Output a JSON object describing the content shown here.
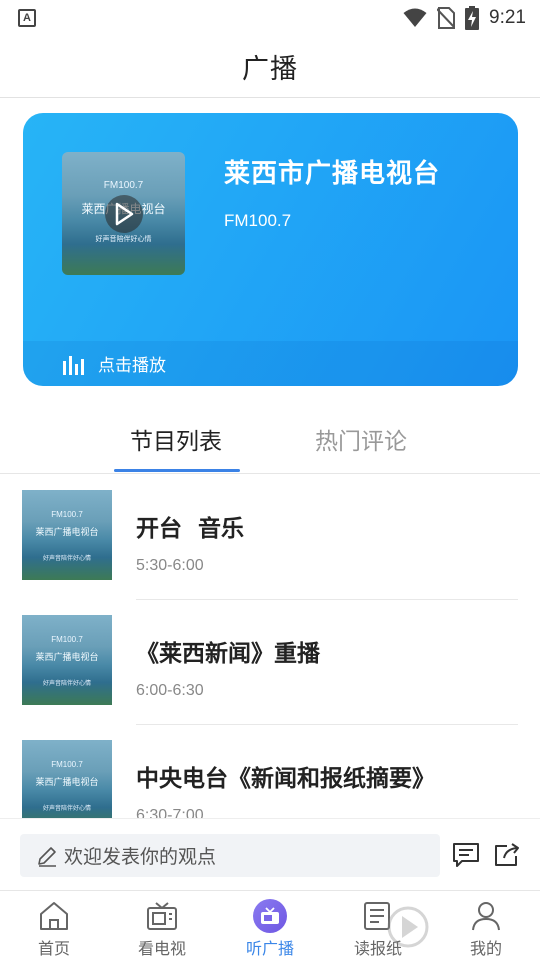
{
  "status_bar": {
    "badge": "A",
    "time": "9:21"
  },
  "header": {
    "title": "广播"
  },
  "radio_card": {
    "station_name": "莱西市广播电视台",
    "frequency": "FM100.7",
    "action_label": "点击播放",
    "cover_text": {
      "line1": "FM100.7",
      "line2": "莱西广播电视台",
      "line3": "好声音陪伴好心情"
    },
    "accent_color": "#1a95f5"
  },
  "tabs": [
    {
      "label": "节目列表",
      "active": true
    },
    {
      "label": "热门评论",
      "active": false
    }
  ],
  "programs": [
    {
      "title": "开台  音乐",
      "time": "5:30-6:00"
    },
    {
      "title": "《莱西新闻》重播",
      "time": "6:00-6:30"
    },
    {
      "title": "中央电台《新闻和报纸摘要》",
      "time": "6:30-7:00"
    }
  ],
  "thumb_text": {
    "line1": "FM100.7",
    "line2": "莱西广播电视台",
    "line3": "好声音陪伴好心情"
  },
  "comment_bar": {
    "placeholder": "欢迎发表你的观点",
    "icons": [
      "edit-icon",
      "comment-icon",
      "share-icon"
    ]
  },
  "bottom_nav": [
    {
      "label": "首页",
      "icon": "home-icon",
      "active": false
    },
    {
      "label": "看电视",
      "icon": "tv-icon",
      "active": false
    },
    {
      "label": "听广播",
      "icon": "radio-icon",
      "active": true
    },
    {
      "label": "读报纸",
      "icon": "newspaper-icon",
      "active": false
    },
    {
      "label": "我的",
      "icon": "profile-icon",
      "active": false
    }
  ],
  "colors": {
    "tab_active_underline": "#3b82e6",
    "nav_active": "#3a86e8"
  }
}
